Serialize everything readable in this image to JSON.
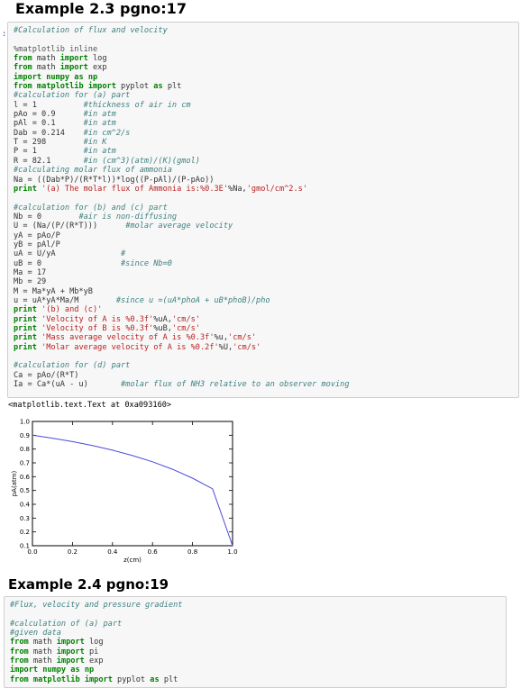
{
  "headings": {
    "example_23": "Example 2.3 pgno:17",
    "example_24": "Example 2.4 pgno:19"
  },
  "cell1": {
    "prompt": ":",
    "lines": [
      [
        {
          "t": "cm",
          "v": "#Calculation of flux and velocity"
        }
      ],
      [
        {
          "t": "p",
          "v": ""
        }
      ],
      [
        {
          "t": "mg",
          "v": "%matplotlib inline"
        }
      ],
      [
        {
          "t": "kw",
          "v": "from"
        },
        {
          "t": "p",
          "v": " math "
        },
        {
          "t": "kw",
          "v": "import"
        },
        {
          "t": "p",
          "v": " log"
        }
      ],
      [
        {
          "t": "kw",
          "v": "from"
        },
        {
          "t": "p",
          "v": " math "
        },
        {
          "t": "kw",
          "v": "import"
        },
        {
          "t": "p",
          "v": " exp"
        }
      ],
      [
        {
          "t": "kw",
          "v": "import"
        },
        {
          "t": "p",
          "v": " "
        },
        {
          "t": "kw",
          "v": "numpy"
        },
        {
          "t": "p",
          "v": " "
        },
        {
          "t": "kw",
          "v": "as"
        },
        {
          "t": "p",
          "v": " "
        },
        {
          "t": "kw",
          "v": "np"
        }
      ],
      [
        {
          "t": "kw",
          "v": "from"
        },
        {
          "t": "p",
          "v": " "
        },
        {
          "t": "kw",
          "v": "matplotlib"
        },
        {
          "t": "p",
          "v": " "
        },
        {
          "t": "kw",
          "v": "import"
        },
        {
          "t": "p",
          "v": " pyplot "
        },
        {
          "t": "kw",
          "v": "as"
        },
        {
          "t": "p",
          "v": " plt"
        }
      ],
      [
        {
          "t": "cm",
          "v": "#calculation for (a) part"
        }
      ],
      [
        {
          "t": "p",
          "v": "l = 1          "
        },
        {
          "t": "cm",
          "v": "#thickness of air in cm"
        }
      ],
      [
        {
          "t": "p",
          "v": "pAo = 0.9      "
        },
        {
          "t": "cm",
          "v": "#in atm"
        }
      ],
      [
        {
          "t": "p",
          "v": "pAl = 0.1      "
        },
        {
          "t": "cm",
          "v": "#in atm"
        }
      ],
      [
        {
          "t": "p",
          "v": "Dab = 0.214    "
        },
        {
          "t": "cm",
          "v": "#in cm^2/s"
        }
      ],
      [
        {
          "t": "p",
          "v": "T = 298        "
        },
        {
          "t": "cm",
          "v": "#in K"
        }
      ],
      [
        {
          "t": "p",
          "v": "P = 1          "
        },
        {
          "t": "cm",
          "v": "#in atm"
        }
      ],
      [
        {
          "t": "p",
          "v": "R = 82.1       "
        },
        {
          "t": "cm",
          "v": "#in (cm^3)(atm)/(K)(gmol)"
        }
      ],
      [
        {
          "t": "cm",
          "v": "#calculating molar flux of ammonia"
        }
      ],
      [
        {
          "t": "p",
          "v": "Na = ((Dab*P)/(R*T*l))*log((P-pAl)/(P-pAo))"
        }
      ],
      [
        {
          "t": "kw",
          "v": "print"
        },
        {
          "t": "p",
          "v": " "
        },
        {
          "t": "st",
          "v": "'(a) The molar flux of Ammonia is:%0.3E'"
        },
        {
          "t": "p",
          "v": "%Na,"
        },
        {
          "t": "st",
          "v": "'gmol/cm^2.s'"
        }
      ],
      [
        {
          "t": "p",
          "v": ""
        }
      ],
      [
        {
          "t": "cm",
          "v": "#calculation for (b) and (c) part"
        }
      ],
      [
        {
          "t": "p",
          "v": "Nb = 0        "
        },
        {
          "t": "cm",
          "v": "#air is non-diffusing"
        }
      ],
      [
        {
          "t": "p",
          "v": "U = (Na/(P/(R*T)))      "
        },
        {
          "t": "cm",
          "v": "#molar average velocity"
        }
      ],
      [
        {
          "t": "p",
          "v": "yA = pAo/P"
        }
      ],
      [
        {
          "t": "p",
          "v": "yB = pAl/P"
        }
      ],
      [
        {
          "t": "p",
          "v": "uA = U/yA              "
        },
        {
          "t": "cm",
          "v": "#"
        }
      ],
      [
        {
          "t": "p",
          "v": "uB = 0                 "
        },
        {
          "t": "cm",
          "v": "#since Nb=0"
        }
      ],
      [
        {
          "t": "p",
          "v": "Ma = 17"
        }
      ],
      [
        {
          "t": "p",
          "v": "Mb = 29"
        }
      ],
      [
        {
          "t": "p",
          "v": "M = Ma*yA + Mb*yB"
        }
      ],
      [
        {
          "t": "p",
          "v": "u = uA*yA*Ma/M        "
        },
        {
          "t": "cm",
          "v": "#since u =(uA*phoA + uB*phoB)/pho"
        }
      ],
      [
        {
          "t": "kw",
          "v": "print"
        },
        {
          "t": "p",
          "v": " "
        },
        {
          "t": "st",
          "v": "'(b) and (c)'"
        }
      ],
      [
        {
          "t": "kw",
          "v": "print"
        },
        {
          "t": "p",
          "v": " "
        },
        {
          "t": "st",
          "v": "'Velocity of A is %0.3f'"
        },
        {
          "t": "p",
          "v": "%uA,"
        },
        {
          "t": "st",
          "v": "'cm/s'"
        }
      ],
      [
        {
          "t": "kw",
          "v": "print"
        },
        {
          "t": "p",
          "v": " "
        },
        {
          "t": "st",
          "v": "'Velocity of B is %0.3f'"
        },
        {
          "t": "p",
          "v": "%uB,"
        },
        {
          "t": "st",
          "v": "'cm/s'"
        }
      ],
      [
        {
          "t": "kw",
          "v": "print"
        },
        {
          "t": "p",
          "v": " "
        },
        {
          "t": "st",
          "v": "'Mass average velocity of A is %0.3f'"
        },
        {
          "t": "p",
          "v": "%u,"
        },
        {
          "t": "st",
          "v": "'cm/s'"
        }
      ],
      [
        {
          "t": "kw",
          "v": "print"
        },
        {
          "t": "p",
          "v": " "
        },
        {
          "t": "st",
          "v": "'Molar average velocity of A is %0.2f'"
        },
        {
          "t": "p",
          "v": "%U,"
        },
        {
          "t": "st",
          "v": "'cm/s'"
        }
      ],
      [
        {
          "t": "p",
          "v": ""
        }
      ],
      [
        {
          "t": "cm",
          "v": "#calculation for (d) part"
        }
      ],
      [
        {
          "t": "p",
          "v": "Ca = pAo/(R*T)"
        }
      ],
      [
        {
          "t": "p",
          "v": "Ia = Ca*(uA - u)       "
        },
        {
          "t": "cm",
          "v": "#molar flux of NH3 relative to an observer moving"
        }
      ]
    ]
  },
  "output_text": "<matplotlib.text.Text at 0xa093160>",
  "cell2": {
    "lines": [
      [
        {
          "t": "cm",
          "v": "#Flux, velocity and pressure gradient"
        }
      ],
      [
        {
          "t": "p",
          "v": ""
        }
      ],
      [
        {
          "t": "cm",
          "v": "#calculation of (a) part"
        }
      ],
      [
        {
          "t": "cm",
          "v": "#given data"
        }
      ],
      [
        {
          "t": "kw",
          "v": "from"
        },
        {
          "t": "p",
          "v": " math "
        },
        {
          "t": "kw",
          "v": "import"
        },
        {
          "t": "p",
          "v": " log"
        }
      ],
      [
        {
          "t": "kw",
          "v": "from"
        },
        {
          "t": "p",
          "v": " math "
        },
        {
          "t": "kw",
          "v": "import"
        },
        {
          "t": "p",
          "v": " pi"
        }
      ],
      [
        {
          "t": "kw",
          "v": "from"
        },
        {
          "t": "p",
          "v": " math "
        },
        {
          "t": "kw",
          "v": "import"
        },
        {
          "t": "p",
          "v": " exp"
        }
      ],
      [
        {
          "t": "kw",
          "v": "import"
        },
        {
          "t": "p",
          "v": " "
        },
        {
          "t": "kw",
          "v": "numpy"
        },
        {
          "t": "p",
          "v": " "
        },
        {
          "t": "kw",
          "v": "as"
        },
        {
          "t": "p",
          "v": " "
        },
        {
          "t": "kw",
          "v": "np"
        }
      ],
      [
        {
          "t": "kw",
          "v": "from"
        },
        {
          "t": "p",
          "v": " "
        },
        {
          "t": "kw",
          "v": "matplotlib"
        },
        {
          "t": "p",
          "v": " "
        },
        {
          "t": "kw",
          "v": "import"
        },
        {
          "t": "p",
          "v": " pyplot "
        },
        {
          "t": "kw",
          "v": "as"
        },
        {
          "t": "p",
          "v": " plt"
        }
      ]
    ]
  },
  "chart_data": {
    "type": "line",
    "xlabel": "z(cm)",
    "ylabel": "pA(atm)",
    "xlim": [
      0.0,
      1.0
    ],
    "ylim": [
      0.1,
      1.0
    ],
    "xticks": [
      "0.0",
      "0.2",
      "0.4",
      "0.6",
      "0.8",
      "1.0"
    ],
    "yticks": [
      "0.1",
      "0.2",
      "0.3",
      "0.4",
      "0.5",
      "0.6",
      "0.7",
      "0.8",
      "0.9",
      "1.0"
    ],
    "grid": false,
    "line_color": "#4a4ad8",
    "series": [
      {
        "x": [
          0.0,
          0.1,
          0.2,
          0.3,
          0.4,
          0.5,
          0.6,
          0.7,
          0.8,
          0.9,
          1.0
        ],
        "y": [
          0.9,
          0.879,
          0.854,
          0.825,
          0.792,
          0.753,
          0.708,
          0.654,
          0.589,
          0.512,
          0.1
        ]
      }
    ]
  }
}
